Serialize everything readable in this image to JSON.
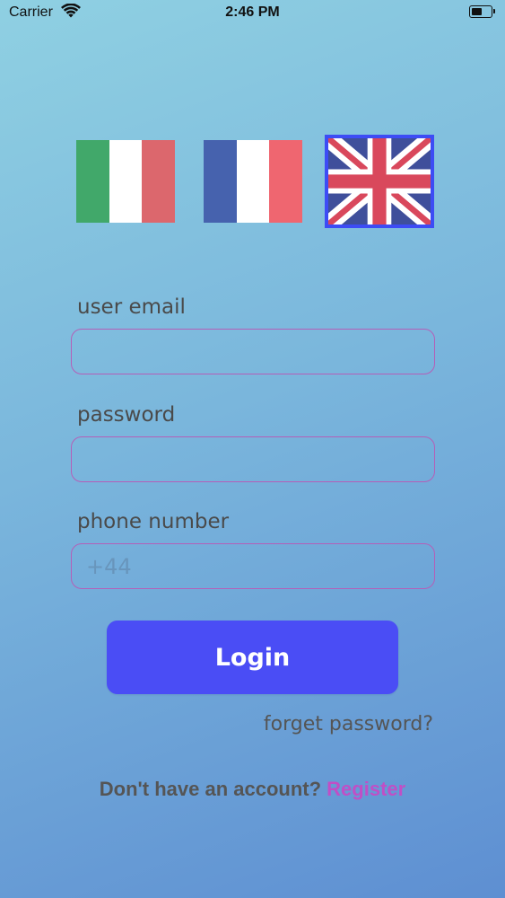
{
  "status_bar": {
    "carrier": "Carrier",
    "time": "2:46 PM",
    "battery_level": 0.55
  },
  "languages": {
    "items": [
      {
        "code": "it",
        "name": "Italian"
      },
      {
        "code": "fr",
        "name": "French"
      },
      {
        "code": "en",
        "name": "English"
      }
    ],
    "selected": "en",
    "selected_border_color": "#3d4cf5"
  },
  "form": {
    "email_label": "user email",
    "email_value": "",
    "password_label": "password",
    "password_value": "",
    "phone_label": "phone number",
    "phone_placeholder": "+44",
    "phone_value": ""
  },
  "actions": {
    "login_label": "Login",
    "forget_label": "forget password?",
    "no_account_text": "Don't have an account?",
    "register_label": "Register"
  },
  "colors": {
    "primary_button": "#4a4df5",
    "field_border": "#b45fb8",
    "register_link": "#c04fc6"
  }
}
